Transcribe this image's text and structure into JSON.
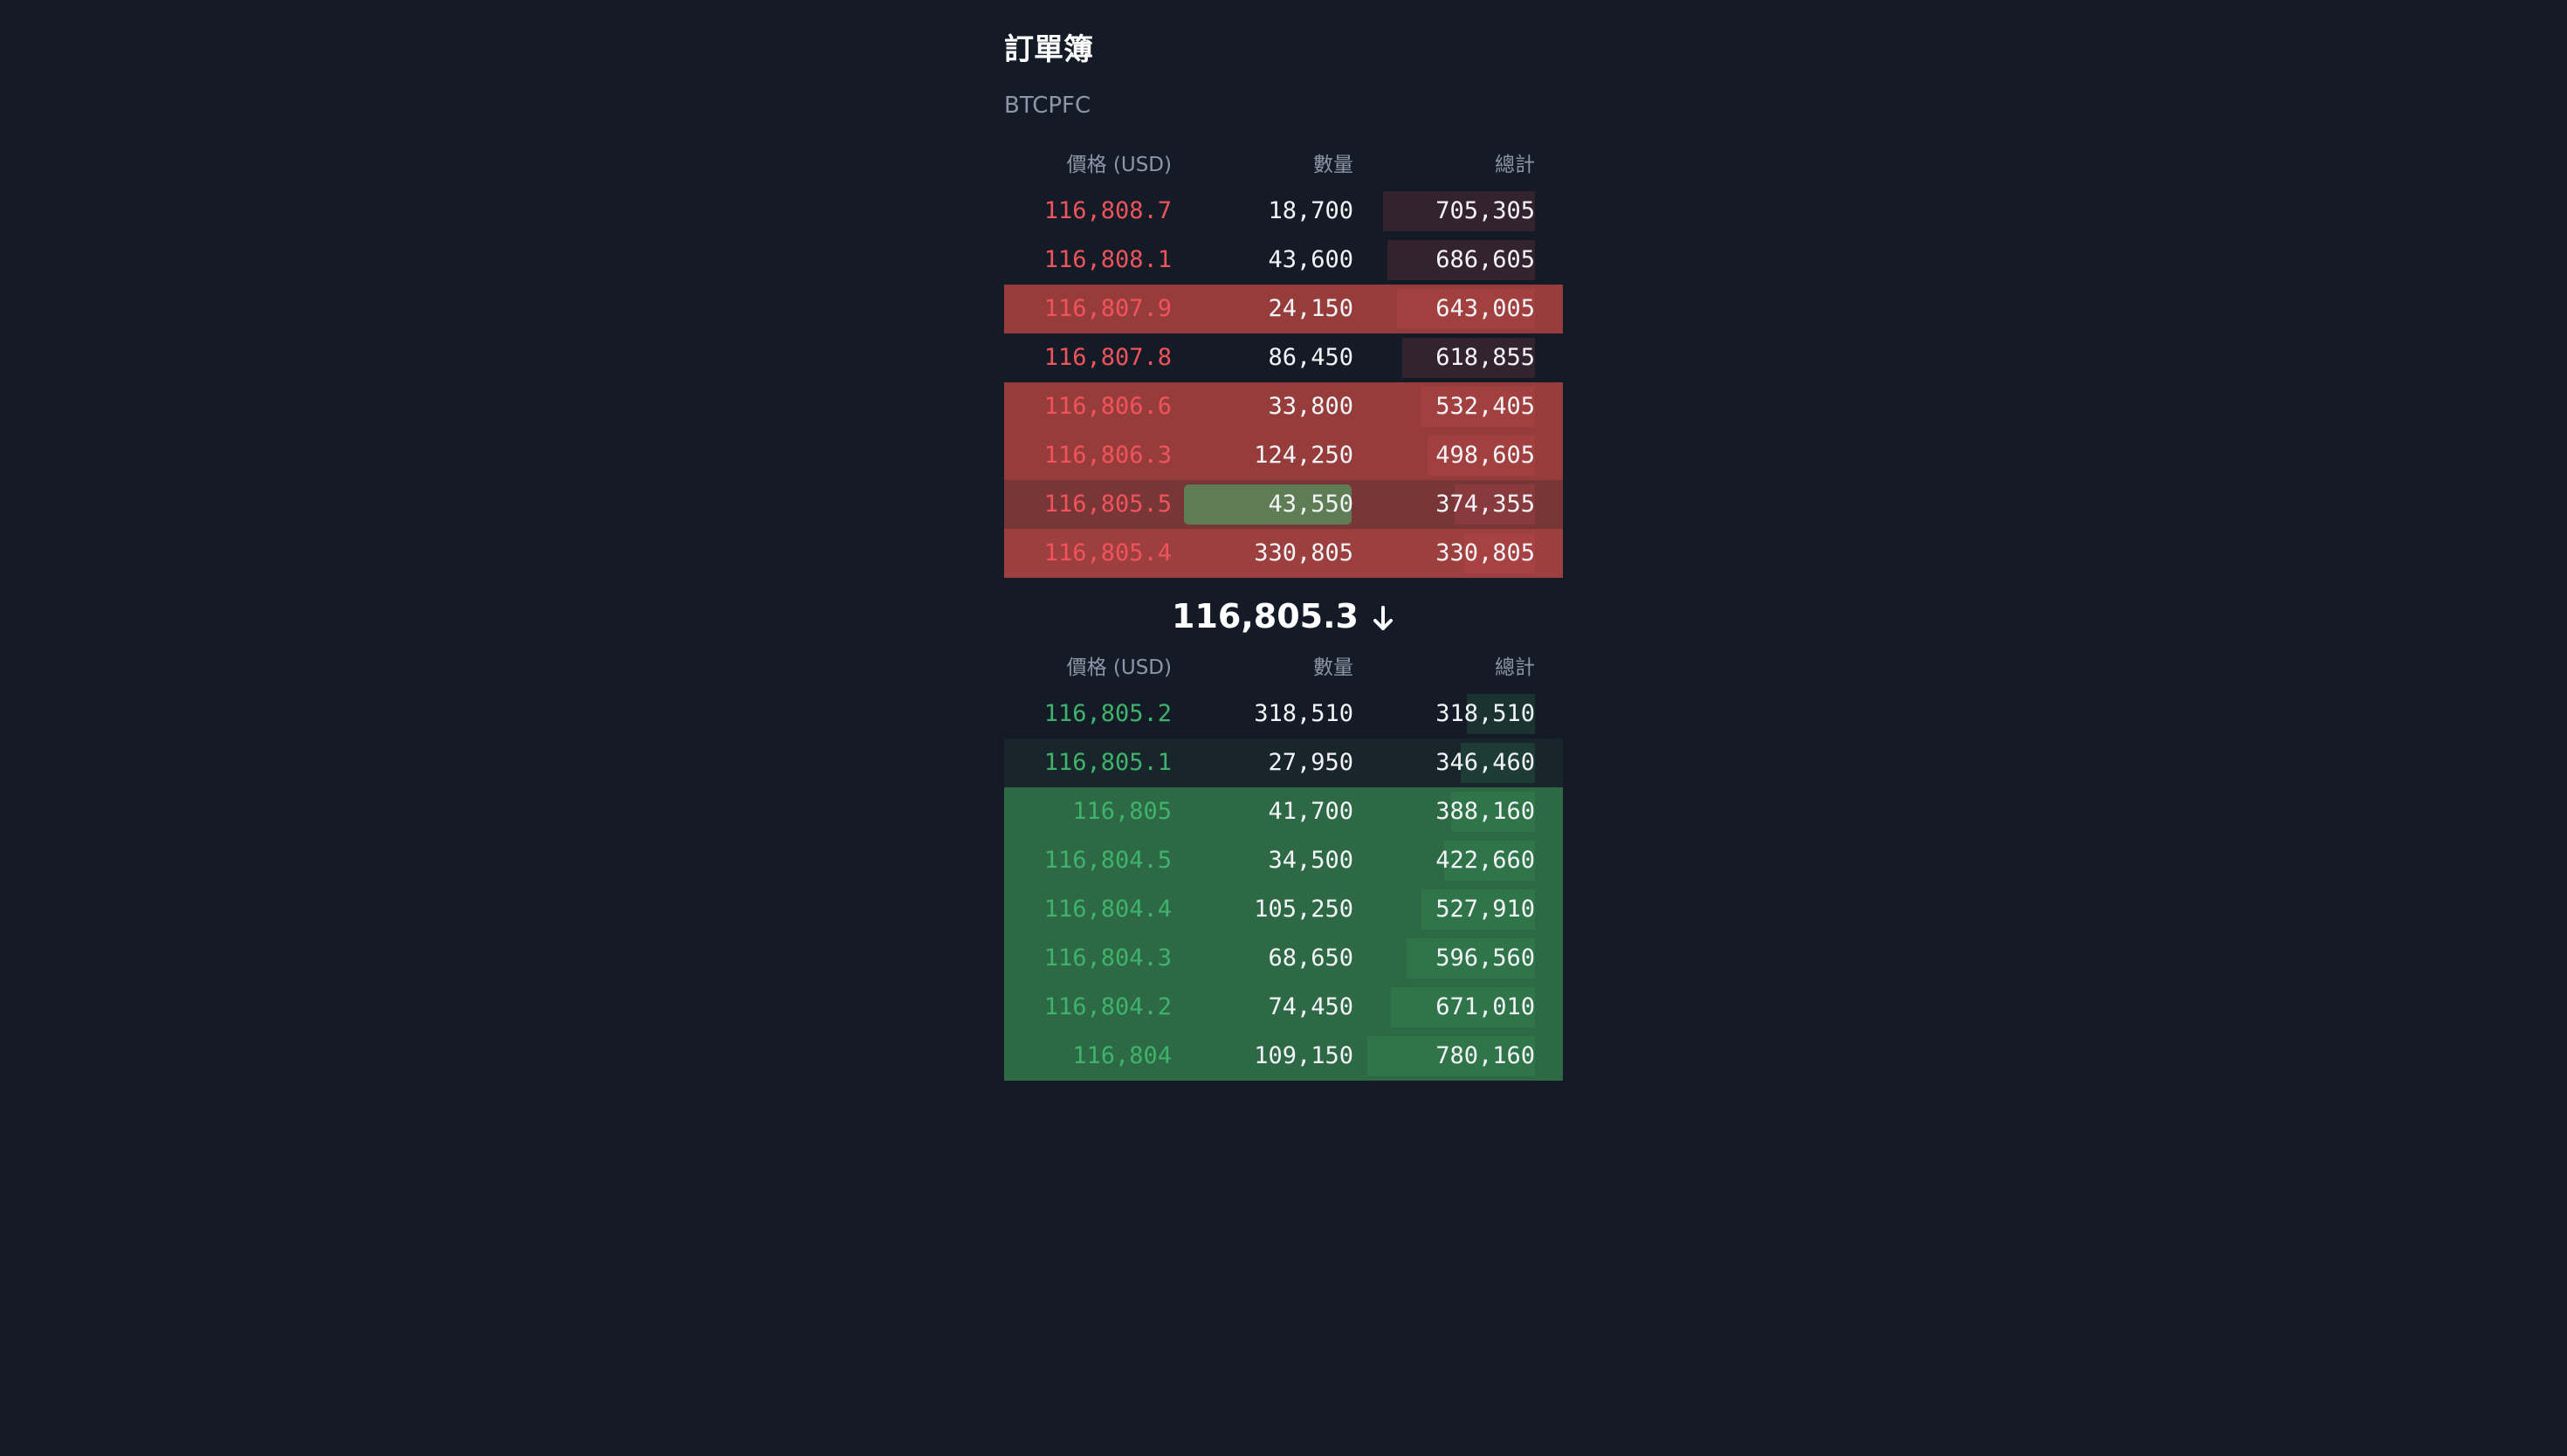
{
  "panel": {
    "title": "訂單簿",
    "symbol": "BTCPFC"
  },
  "columns": {
    "price": "價格 (USD)",
    "size": "數量",
    "total": "總計"
  },
  "colors": {
    "background": "#141b27",
    "ask_text": "#f0545a",
    "bid_text": "#3fb36b",
    "ask_highlight": "#a4413f",
    "bid_highlight": "#2f6e47",
    "size_flash": "#5f7d54"
  },
  "max_total": 780160,
  "asks": [
    {
      "price": "116,808.7",
      "size": "18,700",
      "total": "705,305",
      "total_value": 705305,
      "highlight": 0.0
    },
    {
      "price": "116,808.1",
      "size": "43,600",
      "total": "686,605",
      "total_value": 686605,
      "highlight": 0.0
    },
    {
      "price": "116,807.9",
      "size": "24,150",
      "total": "643,005",
      "total_value": 643005,
      "highlight": 0.9
    },
    {
      "price": "116,807.8",
      "size": "86,450",
      "total": "618,855",
      "total_value": 618855,
      "highlight": 0.0
    },
    {
      "price": "116,806.6",
      "size": "33,800",
      "total": "532,405",
      "total_value": 532405,
      "highlight": 0.9
    },
    {
      "price": "116,806.3",
      "size": "124,250",
      "total": "498,605",
      "total_value": 498605,
      "highlight": 0.9
    },
    {
      "price": "116,805.5",
      "size": "43,550",
      "total": "374,355",
      "total_value": 374355,
      "highlight": 0.7,
      "size_flash": true
    },
    {
      "price": "116,805.4",
      "size": "330,805",
      "total": "330,805",
      "total_value": 330805,
      "highlight": 0.95
    }
  ],
  "last_price": {
    "value": "116,805.3",
    "direction": "down"
  },
  "bids": [
    {
      "price": "116,805.2",
      "size": "318,510",
      "total": "318,510",
      "total_value": 318510,
      "highlight": 0.0
    },
    {
      "price": "116,805.1",
      "size": "27,950",
      "total": "346,460",
      "total_value": 346460,
      "highlight": 0.15
    },
    {
      "price": "116,805",
      "size": "41,700",
      "total": "388,160",
      "total_value": 388160,
      "highlight": 0.95
    },
    {
      "price": "116,804.5",
      "size": "34,500",
      "total": "422,660",
      "total_value": 422660,
      "highlight": 0.95
    },
    {
      "price": "116,804.4",
      "size": "105,250",
      "total": "527,910",
      "total_value": 527910,
      "highlight": 0.95
    },
    {
      "price": "116,804.3",
      "size": "68,650",
      "total": "596,560",
      "total_value": 596560,
      "highlight": 0.95
    },
    {
      "price": "116,804.2",
      "size": "74,450",
      "total": "671,010",
      "total_value": 671010,
      "highlight": 0.95
    },
    {
      "price": "116,804",
      "size": "109,150",
      "total": "780,160",
      "total_value": 780160,
      "highlight": 0.95
    }
  ]
}
